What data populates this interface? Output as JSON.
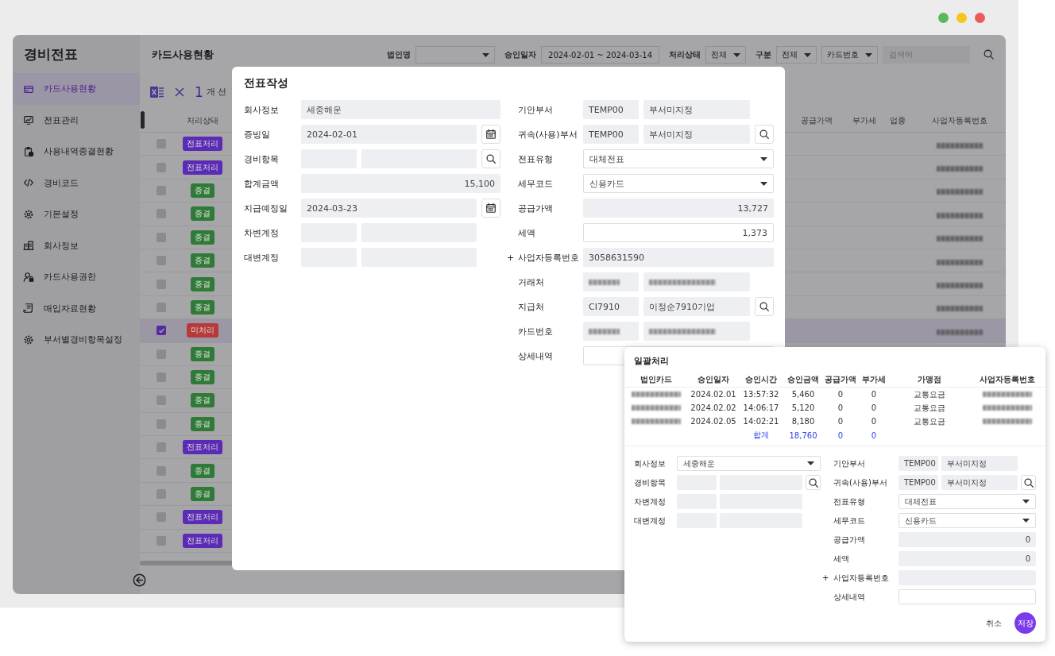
{
  "sidebar": {
    "title": "경비전표",
    "items": [
      {
        "label": "카드사용현황",
        "selected": true
      },
      {
        "label": "전표관리",
        "selected": false
      },
      {
        "label": "사용내역종결현황",
        "selected": false
      },
      {
        "label": "경비코드",
        "selected": false
      },
      {
        "label": "기본설정",
        "selected": false
      },
      {
        "label": "회사정보",
        "selected": false
      },
      {
        "label": "카드사용권한",
        "selected": false
      },
      {
        "label": "매입자료현황",
        "selected": false
      },
      {
        "label": "부서별경비항목설정",
        "selected": false
      }
    ]
  },
  "header": {
    "title": "카드사용현황",
    "filters": [
      {
        "kind": "label",
        "text": "법인명"
      },
      {
        "kind": "select"
      },
      {
        "kind": "label",
        "text": "승인일자"
      },
      {
        "kind": "range",
        "value": "2024-02-01 ~ 2024-03-14"
      },
      {
        "kind": "label",
        "text": "처리상태"
      },
      {
        "kind": "select",
        "value": "전체"
      },
      {
        "kind": "label",
        "text": "구분"
      },
      {
        "kind": "select",
        "value": "전체"
      },
      {
        "kind": "select",
        "value": "카드번호"
      },
      {
        "kind": "input",
        "placeholder": "검색어"
      },
      {
        "kind": "search"
      }
    ]
  },
  "toolbar": {
    "count": "1",
    "count_label": "개 선"
  },
  "table": {
    "columns": [
      "처리상태",
      "공급가액",
      "부가세",
      "업종",
      "사업자등록번호"
    ],
    "rows": [
      {
        "status": "전표처리",
        "color": "#5b2bb5",
        "checked": false,
        "selected": false
      },
      {
        "status": "전표처리",
        "color": "#5b2bb5",
        "checked": false,
        "selected": false
      },
      {
        "status": "종결",
        "color": "#2e7a36",
        "checked": false,
        "selected": false
      },
      {
        "status": "종결",
        "color": "#2e7a36",
        "checked": false,
        "selected": false
      },
      {
        "status": "종결",
        "color": "#2e7a36",
        "checked": false,
        "selected": false
      },
      {
        "status": "종결",
        "color": "#2e7a36",
        "checked": false,
        "selected": false
      },
      {
        "status": "종결",
        "color": "#2e7a36",
        "checked": false,
        "selected": false
      },
      {
        "status": "종결",
        "color": "#2e7a36",
        "checked": false,
        "selected": false
      },
      {
        "status": "미처리",
        "color": "#b73a3a",
        "checked": true,
        "selected": true
      },
      {
        "status": "종결",
        "color": "#2e7a36",
        "checked": false,
        "selected": false
      },
      {
        "status": "종결",
        "color": "#2e7a36",
        "checked": false,
        "selected": false
      },
      {
        "status": "종결",
        "color": "#2e7a36",
        "checked": false,
        "selected": false
      },
      {
        "status": "종결",
        "color": "#2e7a36",
        "checked": false,
        "selected": false
      },
      {
        "status": "전표처리",
        "color": "#5b2bb5",
        "checked": false,
        "selected": false
      },
      {
        "status": "종결",
        "color": "#2e7a36",
        "checked": false,
        "selected": false
      },
      {
        "status": "종결",
        "color": "#2e7a36",
        "checked": false,
        "selected": false
      },
      {
        "status": "전표처리",
        "color": "#5b2bb5",
        "checked": false,
        "selected": false
      },
      {
        "status": "전표처리",
        "color": "#5b2bb5",
        "checked": false,
        "selected": false
      }
    ]
  },
  "voucher_dialog": {
    "title": "전표작성",
    "left": [
      {
        "label": "회사정보",
        "fields": [
          {
            "kind": "text",
            "value": "세중해운"
          }
        ]
      },
      {
        "label": "증빙일",
        "fields": [
          {
            "kind": "text",
            "value": "2024-02-01"
          },
          {
            "kind": "calendar"
          }
        ]
      },
      {
        "label": "경비항목",
        "fields": [
          {
            "kind": "text"
          },
          {
            "kind": "text"
          },
          {
            "kind": "search"
          }
        ]
      },
      {
        "label": "합계금액",
        "fields": [
          {
            "kind": "amount",
            "value": "15,100"
          }
        ]
      },
      {
        "label": "지급예정일",
        "fields": [
          {
            "kind": "text",
            "value": "2024-03-23"
          },
          {
            "kind": "calendar"
          }
        ]
      },
      {
        "label": "차변계정",
        "fields": [
          {
            "kind": "text"
          },
          {
            "kind": "text"
          }
        ]
      },
      {
        "label": "대변계정",
        "fields": [
          {
            "kind": "text"
          },
          {
            "kind": "text"
          }
        ]
      }
    ],
    "right": [
      {
        "label": "기안부서",
        "fields": [
          {
            "kind": "text",
            "value": "TEMP00"
          },
          {
            "kind": "text",
            "value": "부서미지정"
          }
        ]
      },
      {
        "label": "귀속(사용)부서",
        "fields": [
          {
            "kind": "text",
            "value": "TEMP00"
          },
          {
            "kind": "text",
            "value": "부서미지정"
          },
          {
            "kind": "search"
          }
        ]
      },
      {
        "label": "전표유형",
        "fields": [
          {
            "kind": "select",
            "value": "대체전표"
          }
        ]
      },
      {
        "label": "세무코드",
        "fields": [
          {
            "kind": "select",
            "value": "신용카드"
          }
        ]
      },
      {
        "label": "공급가액",
        "fields": [
          {
            "kind": "amount",
            "value": "13,727"
          }
        ]
      },
      {
        "label": "세액",
        "fields": [
          {
            "kind": "input-amount",
            "value": "1,373"
          }
        ]
      },
      {
        "prefix": "+",
        "label": "사업자등록번호",
        "fields": [
          {
            "kind": "text",
            "value": "3058631590"
          }
        ]
      },
      {
        "label": "거래처",
        "fields": [
          {
            "kind": "redacted"
          },
          {
            "kind": "redacted"
          }
        ]
      },
      {
        "label": "지급처",
        "fields": [
          {
            "kind": "text",
            "value": "CI7910"
          },
          {
            "kind": "text",
            "value": "이정순7910기업"
          },
          {
            "kind": "search"
          }
        ]
      },
      {
        "label": "카드번호",
        "fields": [
          {
            "kind": "redacted"
          },
          {
            "kind": "redacted"
          }
        ]
      },
      {
        "label": "상세내역",
        "fields": [
          {
            "kind": "input"
          }
        ]
      }
    ]
  },
  "batch_dialog": {
    "title": "일괄처리",
    "table": {
      "columns": [
        "법인카드",
        "승인일자",
        "승인시간",
        "승인금액",
        "공급가액",
        "부가세",
        "가맹점",
        "사업자등록번호"
      ],
      "rows": [
        {
          "cells": [
            {
              "kind": "redacted"
            },
            {
              "text": "2024.02.01"
            },
            {
              "text": "13:57:32"
            },
            {
              "text": "5,460"
            },
            {
              "text": "0"
            },
            {
              "text": "0"
            },
            {
              "text": "교통요금"
            },
            {
              "kind": "redacted"
            }
          ]
        },
        {
          "cells": [
            {
              "kind": "redacted"
            },
            {
              "text": "2024.02.02"
            },
            {
              "text": "14:06:17"
            },
            {
              "text": "5,120"
            },
            {
              "text": "0"
            },
            {
              "text": "0"
            },
            {
              "text": "교통요금"
            },
            {
              "kind": "redacted"
            }
          ]
        },
        {
          "cells": [
            {
              "kind": "redacted"
            },
            {
              "text": "2024.02.05"
            },
            {
              "text": "14:02:21"
            },
            {
              "text": "8,180"
            },
            {
              "text": "0"
            },
            {
              "text": "0"
            },
            {
              "text": "교통요금"
            },
            {
              "kind": "redacted"
            }
          ]
        }
      ],
      "total": {
        "label": "합계",
        "values": [
          "18,760",
          "0",
          "0"
        ]
      }
    },
    "left": [
      {
        "label": "회사정보",
        "fields": [
          {
            "kind": "select",
            "value": "세중해운"
          }
        ]
      },
      {
        "label": "경비항목",
        "fields": [
          {
            "kind": "text"
          },
          {
            "kind": "text"
          },
          {
            "kind": "search"
          }
        ]
      },
      {
        "label": "차변계정",
        "fields": [
          {
            "kind": "text"
          },
          {
            "kind": "text"
          }
        ]
      },
      {
        "label": "대변계정",
        "fields": [
          {
            "kind": "text"
          },
          {
            "kind": "text"
          }
        ]
      }
    ],
    "right": [
      {
        "label": "기안부서",
        "fields": [
          {
            "kind": "text",
            "value": "TEMP00"
          },
          {
            "kind": "text",
            "value": "부서미지정"
          }
        ]
      },
      {
        "label": "귀속(사용)부서",
        "fields": [
          {
            "kind": "text",
            "value": "TEMP00"
          },
          {
            "kind": "text",
            "value": "부서미지정"
          },
          {
            "kind": "search"
          }
        ]
      },
      {
        "label": "전표유형",
        "fields": [
          {
            "kind": "select",
            "value": "대체전표"
          }
        ]
      },
      {
        "label": "세무코드",
        "fields": [
          {
            "kind": "select",
            "value": "신용카드"
          }
        ]
      },
      {
        "label": "공급가액",
        "fields": [
          {
            "kind": "amount",
            "value": "0"
          }
        ]
      },
      {
        "label": "세액",
        "fields": [
          {
            "kind": "amount",
            "value": "0"
          }
        ]
      },
      {
        "prefix": "+",
        "label": "사업자등록번호",
        "fields": [
          {
            "kind": "text"
          }
        ]
      },
      {
        "label": "상세내역",
        "fields": [
          {
            "kind": "input"
          }
        ]
      }
    ],
    "buttons": [
      {
        "kind": "plain",
        "label": "취소"
      },
      {
        "kind": "primary",
        "label": "저장"
      }
    ]
  }
}
